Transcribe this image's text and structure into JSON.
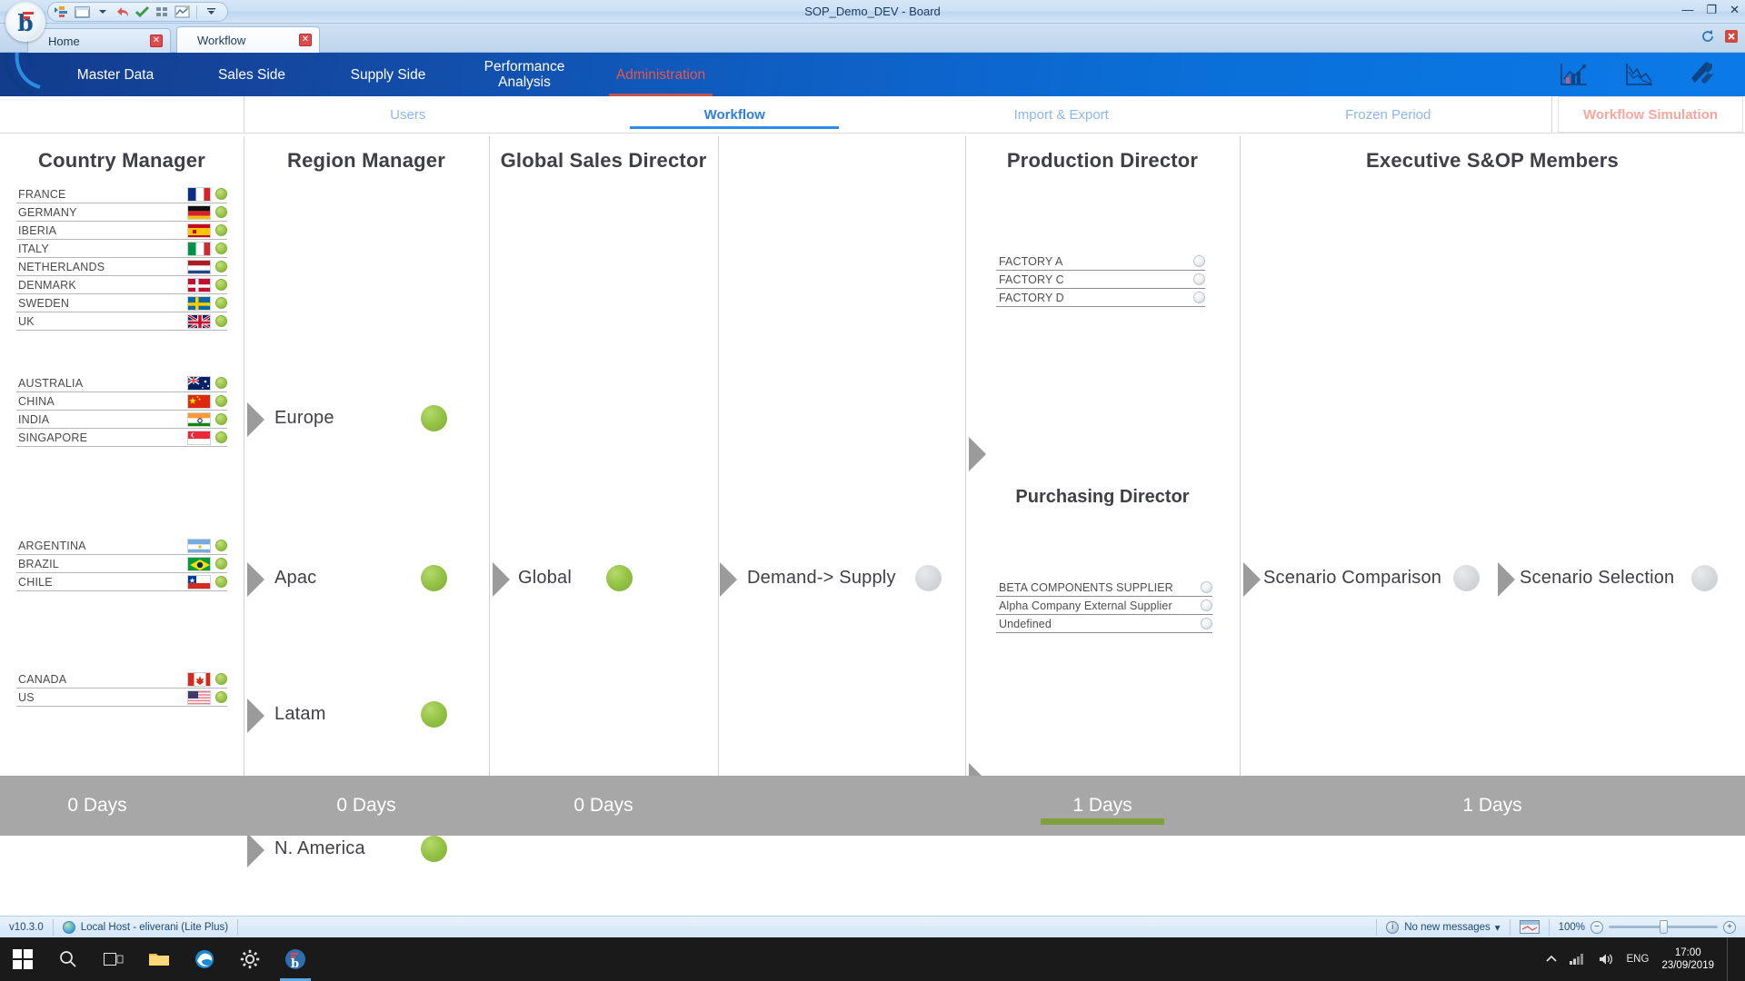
{
  "window": {
    "title": "SOP_Demo_DEV - Board",
    "minimize_label": "—",
    "maximize_label": "❐",
    "close_label": "✕",
    "quick_access": [
      "run-icon",
      "window-icon",
      "dropdown-icon",
      "undo-icon",
      "check-icon",
      "grid-icon",
      "chart-icon",
      "customize-icon"
    ]
  },
  "doc_tabs": [
    {
      "label": "Home",
      "close": "✕",
      "active": false
    },
    {
      "label": "Workflow",
      "close": "✕",
      "active": true
    }
  ],
  "tabstrip_icons": [
    "refresh-icon",
    "close-all-icon"
  ],
  "main_nav": {
    "items": [
      {
        "label": "Master Data",
        "active": false
      },
      {
        "label": "Sales Side",
        "active": false
      },
      {
        "label": "Supply Side",
        "active": false
      },
      {
        "label": "Performance\nAnalysis",
        "line1": "Performance",
        "line2": "Analysis",
        "active": false
      },
      {
        "label": "Administration",
        "active": true
      }
    ],
    "right_icons": [
      "bar-chart-icon",
      "line-chart-icon",
      "tools-icon"
    ]
  },
  "sub_nav": {
    "items": [
      {
        "label": "Users",
        "active": false
      },
      {
        "label": "Workflow",
        "active": true
      },
      {
        "label": "Import & Export",
        "active": false
      },
      {
        "label": "Frozen Period",
        "active": false
      }
    ],
    "simulation_button": "Workflow Simulation"
  },
  "columns": [
    {
      "title": "Country Manager"
    },
    {
      "title": "Region Manager"
    },
    {
      "title": "Global Sales Director"
    },
    {
      "title": ""
    },
    {
      "title": "Production Director",
      "secondary_title": "Purchasing Director"
    },
    {
      "title": "Executive S&OP Members"
    }
  ],
  "country_groups": [
    {
      "region": "Europe",
      "countries": [
        {
          "name": "FRANCE",
          "flag": "fr",
          "status": "green"
        },
        {
          "name": "GERMANY",
          "flag": "de",
          "status": "green"
        },
        {
          "name": "IBERIA",
          "flag": "es",
          "status": "green"
        },
        {
          "name": "ITALY",
          "flag": "it",
          "status": "green"
        },
        {
          "name": "NETHERLANDS",
          "flag": "nl",
          "status": "green"
        },
        {
          "name": "DENMARK",
          "flag": "dk",
          "status": "green"
        },
        {
          "name": "SWEDEN",
          "flag": "se",
          "status": "green"
        },
        {
          "name": "UK",
          "flag": "gb",
          "status": "green"
        }
      ]
    },
    {
      "region": "Apac",
      "countries": [
        {
          "name": "AUSTRALIA",
          "flag": "au",
          "status": "green"
        },
        {
          "name": "CHINA",
          "flag": "cn",
          "status": "green"
        },
        {
          "name": "INDIA",
          "flag": "in",
          "status": "green"
        },
        {
          "name": "SINGAPORE",
          "flag": "sg",
          "status": "green"
        }
      ]
    },
    {
      "region": "Latam",
      "countries": [
        {
          "name": "ARGENTINA",
          "flag": "ar",
          "status": "green"
        },
        {
          "name": "BRAZIL",
          "flag": "br",
          "status": "green"
        },
        {
          "name": "CHILE",
          "flag": "cl",
          "status": "green"
        }
      ]
    },
    {
      "region": "N. America",
      "countries": [
        {
          "name": "CANADA",
          "flag": "ca",
          "status": "green"
        },
        {
          "name": "US",
          "flag": "us",
          "status": "green"
        }
      ]
    }
  ],
  "regions": [
    {
      "label": "Europe",
      "status": "green"
    },
    {
      "label": "Apac",
      "status": "green"
    },
    {
      "label": "Latam",
      "status": "green"
    },
    {
      "label": "N. America",
      "status": "green"
    }
  ],
  "global_node": {
    "label": "Global",
    "status": "green"
  },
  "demand_node": {
    "label": "Demand-> Supply",
    "status": "grey"
  },
  "factories": [
    {
      "name": "FACTORY A",
      "status": "grey"
    },
    {
      "name": "FACTORY C",
      "status": "grey"
    },
    {
      "name": "FACTORY D",
      "status": "grey"
    }
  ],
  "suppliers": [
    {
      "name": "BETA COMPONENTS SUPPLIER",
      "status": "grey"
    },
    {
      "name": "Alpha Company External Supplier",
      "status": "grey"
    },
    {
      "name": "Undefined",
      "status": "grey"
    }
  ],
  "executive_nodes": [
    {
      "label": "Scenario Comparison",
      "status": "grey"
    },
    {
      "label": "Scenario Selection",
      "status": "grey"
    }
  ],
  "days_bar": [
    {
      "value": "0 Days",
      "marked": false
    },
    {
      "value": "0 Days",
      "marked": false
    },
    {
      "value": "0 Days",
      "marked": false
    },
    {
      "value": "1 Days",
      "marked": true
    },
    {
      "value": "1 Days",
      "marked": false
    }
  ],
  "status_bar": {
    "version": "v10.3.0",
    "connection": "Local Host - eliverani (Lite Plus)",
    "messages": "No new messages",
    "messages_caret": "▾",
    "zoom": "100%",
    "zoom_out": "−",
    "zoom_in": "+"
  },
  "taskbar": {
    "items": [
      "start-icon",
      "search-icon",
      "task-view-icon",
      "file-explorer-icon",
      "edge-icon",
      "settings-icon",
      "board-app-icon"
    ],
    "tray": [
      "show-hidden-icon",
      "network-icon",
      "volume-icon"
    ],
    "language": "ENG",
    "time": "17:00",
    "date": "23/09/2019"
  },
  "colors": {
    "nav_blue_dark": "#123c8c",
    "nav_blue_light": "#0b7ae8",
    "active_red": "#e8564a",
    "sub_active": "#2f7fe0",
    "sub_inactive": "#8db6ef",
    "green_status": "#93c245",
    "grey_status": "#d6d9db",
    "days_bar_bg": "#a7a7a7",
    "marker_green": "#7fa03c",
    "arrow_grey": "#9b9b9b"
  }
}
